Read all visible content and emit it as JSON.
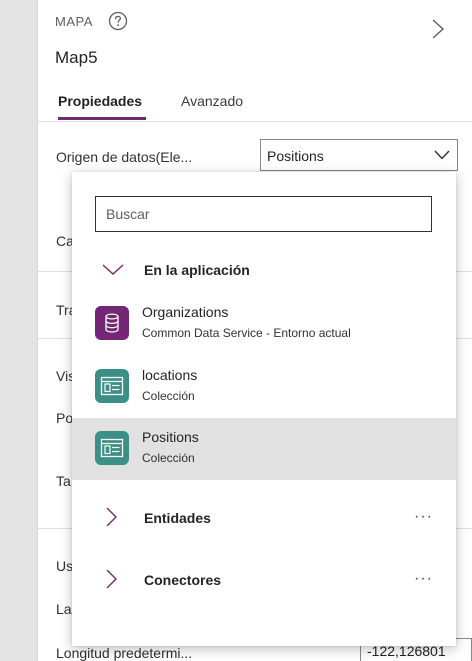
{
  "panel": {
    "control_type": "MAPA",
    "control_name": "Map5",
    "tabs": [
      {
        "label": "Propiedades"
      },
      {
        "label": "Avanzado"
      }
    ]
  },
  "properties": {
    "data_source_label": "Origen de datos(Ele...",
    "data_source_value": "Positions",
    "row_ca": "Ca",
    "row_tra": "Tra",
    "row_vis": "Vis",
    "row_po": "Po",
    "row_ta": "Ta",
    "row_us": "Us",
    "row_la": "La",
    "longitude_label": "Longitud predetermi...",
    "longitude_value": "-122,126801"
  },
  "dropdown": {
    "search_placeholder": "Buscar",
    "group_app": "En la aplicación",
    "items": [
      {
        "title": "Organizations",
        "subtitle": "Common Data Service - Entorno actual",
        "icon": "database-icon",
        "color": "#742774"
      },
      {
        "title": "locations",
        "subtitle": "Colección",
        "icon": "collection-icon",
        "color": "#3b8f86"
      },
      {
        "title": "Positions",
        "subtitle": "Colección",
        "icon": "collection-icon",
        "color": "#3b8f86"
      }
    ],
    "group_entities": "Entidades",
    "group_connectors": "Conectores",
    "more_glyph": "···"
  },
  "colors": {
    "accent": "#742774",
    "collection": "#3b8f86",
    "selected_row": "#e1e1e1"
  }
}
